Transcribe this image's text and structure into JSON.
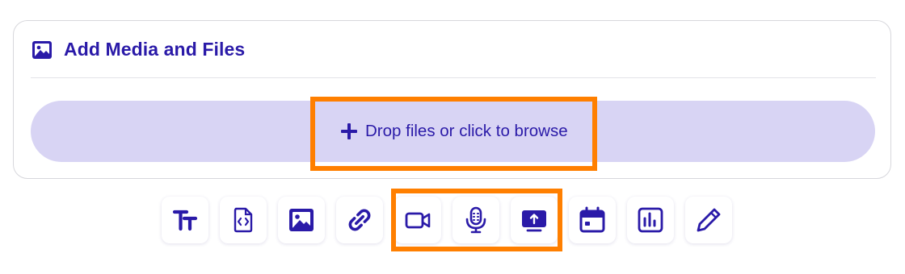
{
  "colors": {
    "accent": "#2a1aa8",
    "dropzone_bg": "#d8d4f4",
    "highlight": "#ff7f00"
  },
  "card": {
    "title": "Add Media and Files",
    "title_icon": "image-icon",
    "dropzone": {
      "label": "Drop files or click to browse",
      "icon": "plus-icon"
    }
  },
  "toolbar": {
    "items": [
      {
        "name": "text",
        "icon": "text-format-icon"
      },
      {
        "name": "code",
        "icon": "code-file-icon"
      },
      {
        "name": "image",
        "icon": "image-icon"
      },
      {
        "name": "link",
        "icon": "link-icon"
      },
      {
        "name": "video",
        "icon": "video-camera-icon"
      },
      {
        "name": "audio",
        "icon": "microphone-icon"
      },
      {
        "name": "screen-share",
        "icon": "screen-upload-icon"
      },
      {
        "name": "calendar",
        "icon": "calendar-icon"
      },
      {
        "name": "chart",
        "icon": "bar-chart-icon"
      },
      {
        "name": "draw",
        "icon": "pencil-icon"
      }
    ]
  }
}
